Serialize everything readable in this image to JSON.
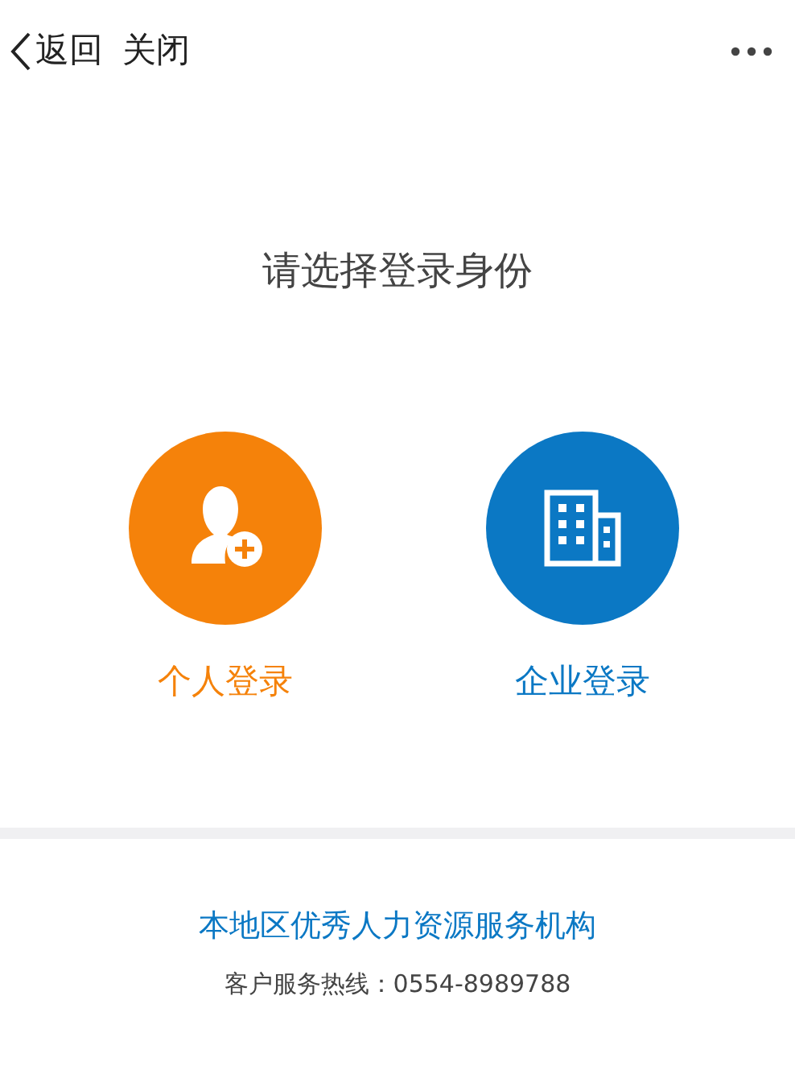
{
  "nav": {
    "back": "返回",
    "close": "关闭"
  },
  "title": "请选择登录身份",
  "options": [
    {
      "kind": "person",
      "label": "个人登录",
      "color": "#f5820a"
    },
    {
      "kind": "company",
      "label": "企业登录",
      "color": "#0b78c4"
    }
  ],
  "footer": {
    "org": "本地区优秀人力资源服务机构",
    "hotline": "客户服务热线：0554-8989788"
  }
}
